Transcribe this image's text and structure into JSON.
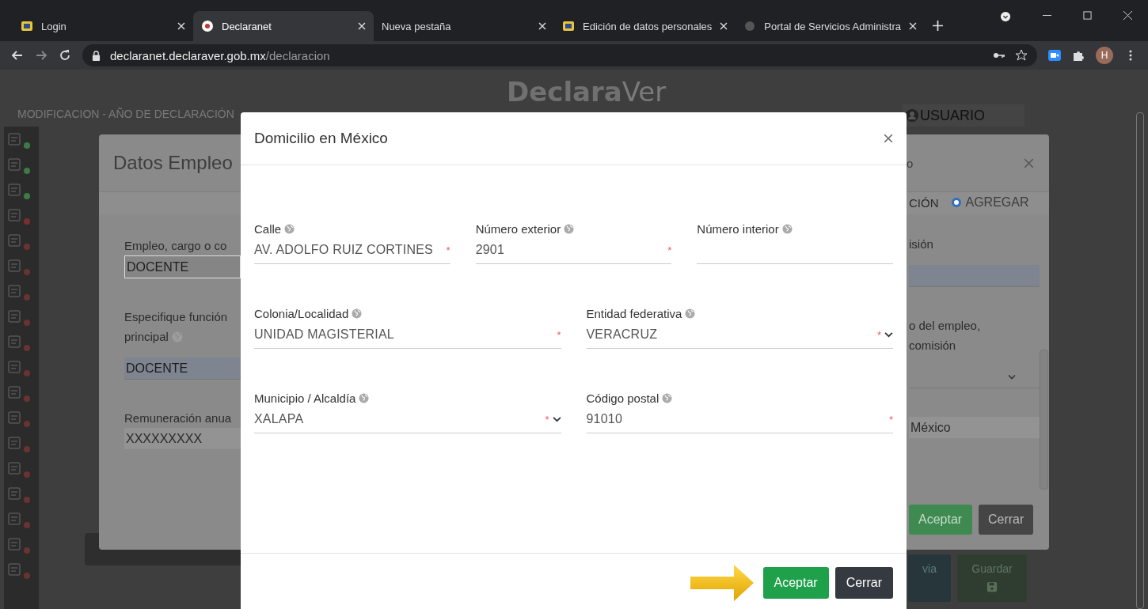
{
  "browser": {
    "tabs": [
      {
        "label": "Login",
        "selected": false
      },
      {
        "label": "Declaranet",
        "selected": true
      },
      {
        "label": "Nueva pestaña",
        "selected": false
      },
      {
        "label": "Edición de datos personales",
        "selected": false
      },
      {
        "label": "Portal de Servicios Administra",
        "selected": false
      }
    ],
    "url_host": "declaranet.declaraver.gob.mx",
    "url_path": "/declaracion",
    "profile_initial": "H"
  },
  "page": {
    "logo_bold": "Declara",
    "logo_light": "Ver",
    "subtitle": "MODIFICACION - AÑO DE DECLARACIÓN",
    "user": "USUARIO",
    "sidebar": [
      {
        "color": "#3d7a45"
      },
      {
        "color": "#3d7a45"
      },
      {
        "color": "#3d7a45"
      },
      {
        "color": "#7a2e2e"
      },
      {
        "color": "#6a3232"
      },
      {
        "color": "#6a3232"
      },
      {
        "color": "#6a3232"
      },
      {
        "color": "#6a3232"
      },
      {
        "color": "#6a3232"
      },
      {
        "color": "#6a3232"
      },
      {
        "color": "#6a3232"
      },
      {
        "color": "#6a3232"
      },
      {
        "color": "#6a3232"
      },
      {
        "color": "#6a3232"
      },
      {
        "color": "#6a3232"
      },
      {
        "color": "#6a3232"
      },
      {
        "color": "#6a3232"
      },
      {
        "color": "#6a3232"
      }
    ],
    "back_buttons": [
      "via",
      "Guardar"
    ]
  },
  "back_modal": {
    "title": "Datos Empleo",
    "title_right": "o",
    "radio_cut_label": "CIÓN",
    "radios": [
      {
        "label": "AGREGAR",
        "selected": true
      }
    ],
    "left_fields": [
      {
        "label": "Empleo, cargo o co",
        "value": "DOCENTE",
        "kind": "outlined"
      },
      {
        "label": "Especifique función",
        "label2": "principal",
        "value": "DOCENTE",
        "kind": "filled"
      },
      {
        "label": "Remuneración anua",
        "value": "XXXXXXXXX",
        "kind": "plain"
      }
    ],
    "right_fields": [
      {
        "label": "isión",
        "kind": "filled"
      },
      {
        "label": "o del empleo,",
        "label2": "comisión",
        "kind": "select"
      },
      {
        "value": "México",
        "kind": "plain"
      }
    ],
    "buttons": [
      {
        "label": "Aceptar",
        "kind": "primary"
      },
      {
        "label": "Cerrar",
        "kind": "secondary"
      }
    ]
  },
  "modal": {
    "title": "Domicilio en México",
    "rows": [
      [
        {
          "label": "Calle",
          "value": "AV. ADOLFO RUIZ CORTINES",
          "marker": "*",
          "kind": "text"
        },
        {
          "label": "Número exterior",
          "value": "2901",
          "marker": "*",
          "kind": "text"
        },
        {
          "label": "Número interior",
          "kind": "text"
        }
      ],
      [
        {
          "label": "Colonia/Localidad",
          "value": "UNIDAD MAGISTERIAL",
          "marker": "*",
          "kind": "text"
        },
        {
          "label": "Entidad federativa",
          "value": "VERACRUZ",
          "marker": "*",
          "kind": "select"
        }
      ],
      [
        {
          "label": "Municipio / Alcaldía",
          "value": "XALAPA",
          "marker": "*",
          "kind": "select"
        },
        {
          "label": "Código postal",
          "value": "91010",
          "marker": "*",
          "kind": "text"
        }
      ]
    ],
    "buttons": [
      {
        "label": "Aceptar",
        "kind": "primary"
      },
      {
        "label": "Cerrar",
        "kind": "secondary"
      }
    ]
  }
}
